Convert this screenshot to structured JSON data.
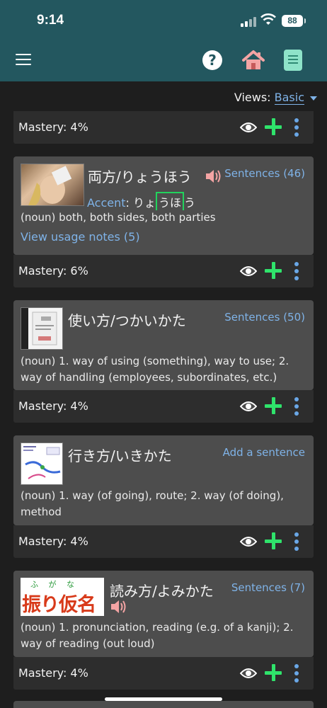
{
  "status": {
    "time": "9:14",
    "battery": "88"
  },
  "header": {
    "menu_icon": "hamburger-icon",
    "help_icon": "question-icon",
    "home_icon": "home-icon",
    "book_icon": "book-icon",
    "help_label": "?"
  },
  "views": {
    "label": "Views:",
    "value": "Basic"
  },
  "labels": {
    "mastery_prefix": "Mastery:"
  },
  "cards": [
    {
      "mastery": "Mastery: 4%"
    },
    {
      "word": "両方/りょうほう",
      "sentences": "Sentences (46)",
      "accent_label": "Accent",
      "accent_colon": ":",
      "accent_before": "りょ",
      "accent_high": "うほ",
      "accent_after": "う",
      "definition": "(noun) both, both sides, both parties",
      "usage_notes": "View usage notes (5)",
      "mastery": "Mastery: 6%"
    },
    {
      "word": "使い方/つかいかた",
      "sentences": "Sentences (50)",
      "definition": "(noun) 1. way of using (something), way to use; 2. way of handling (employees, subordinates, etc.)",
      "mastery": "Mastery: 4%"
    },
    {
      "word": "行き方/いきかた",
      "sentences": "Add a sentence",
      "definition": "(noun) 1. way (of going), route; 2. way (of doing), method",
      "mastery": "Mastery: 4%"
    },
    {
      "word": "読み方/よみかた",
      "sentences": "Sentences (7)",
      "definition": "(noun) 1. pronunciation, reading (e.g. of a kanji); 2. way of reading (out loud)",
      "mastery": "Mastery: 4%",
      "thumb_furigana": "ふ　 が　 な",
      "thumb_text": "振り仮名"
    }
  ],
  "colors": {
    "header": "#23575f",
    "card": "#4d4d4d",
    "footer": "#2d2d2d",
    "link": "#7fb3e8",
    "plus": "#2fe36b",
    "accent_box": "#22d35d"
  }
}
